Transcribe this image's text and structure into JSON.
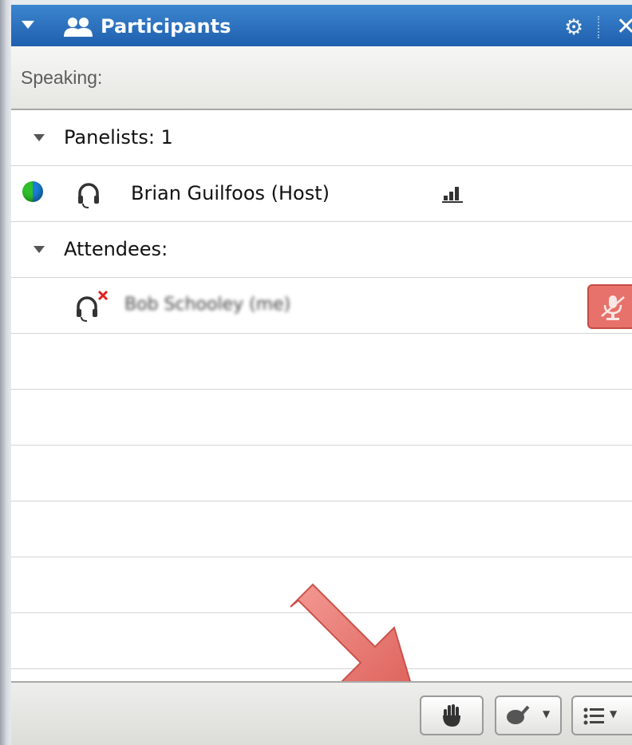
{
  "panel": {
    "title": "Participants",
    "speaking_label": "Speaking:"
  },
  "sections": {
    "panelists_label": "Panelists: 1",
    "attendees_label": "Attendees:"
  },
  "panelists": [
    {
      "name": "Brian Guilfoos (Host)"
    }
  ],
  "attendees": [
    {
      "name": "Bob Schooley (me)",
      "note": "name blurred in screenshot"
    }
  ],
  "toolbar": {
    "buttons": [
      "raise-hand",
      "feedback",
      "list-options"
    ]
  },
  "colors": {
    "titlebar": "#2a6fc0",
    "mute_button": "#e7726b",
    "annotation_arrow": "#e2706a"
  }
}
